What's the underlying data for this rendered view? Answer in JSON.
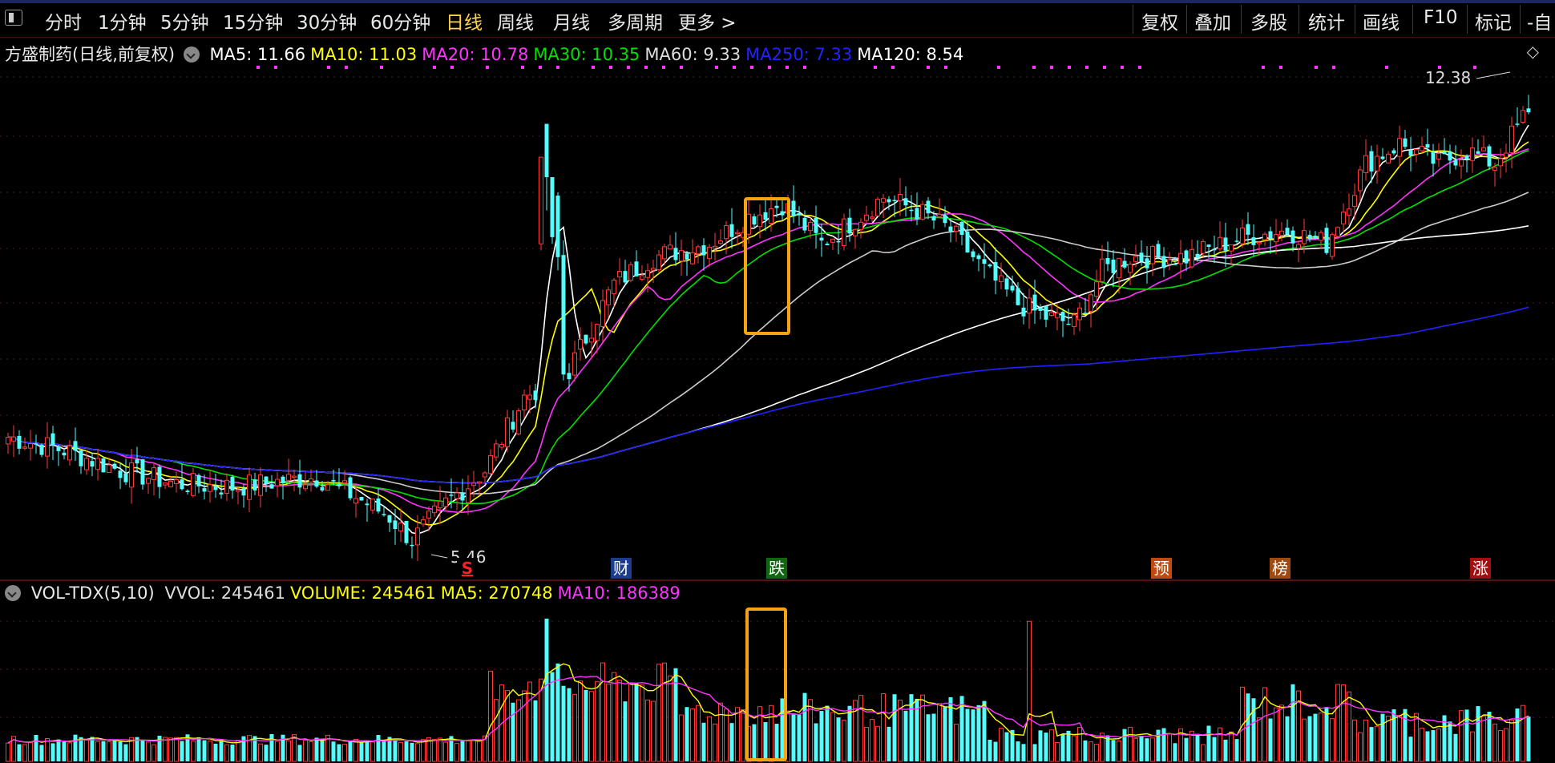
{
  "toolbar": {
    "tabs": [
      "分时",
      "1分钟",
      "5分钟",
      "15分钟",
      "30分钟",
      "60分钟",
      "日线",
      "周线",
      "月线",
      "多周期",
      "更多 >"
    ],
    "active_tab": "日线",
    "right_buttons": [
      "复权",
      "叠加",
      "多股",
      "统计",
      "画线",
      "F10",
      "标记",
      "-自"
    ]
  },
  "price_legend": {
    "title": "方盛制药(日线,前复权)",
    "items": [
      {
        "label": "MA5: 11.66",
        "color": "#ffffff"
      },
      {
        "label": "MA10: 11.03",
        "color": "#ffff00"
      },
      {
        "label": "MA20: 10.78",
        "color": "#ff33ff"
      },
      {
        "label": "MA30: 10.35",
        "color": "#00e000"
      },
      {
        "label": "MA60: 9.33",
        "color": "#dddddd"
      },
      {
        "label": "MA250: 7.33",
        "color": "#2222ff"
      },
      {
        "label": "MA120: 8.54",
        "color": "#ffffff"
      }
    ]
  },
  "annotations": {
    "high_label": "12.38",
    "low_label": "5.46"
  },
  "markers": [
    {
      "text": "S",
      "bg": "#000000",
      "color": "#ff2020"
    },
    {
      "text": "财",
      "bg": "#1e3c8c",
      "color": "#ffffff"
    },
    {
      "text": "跌",
      "bg": "#116611",
      "color": "#ffffff"
    },
    {
      "text": "预",
      "bg": "#c04a10",
      "color": "#ffffff"
    },
    {
      "text": "榜",
      "bg": "#a04a10",
      "color": "#ffffff"
    },
    {
      "text": "涨",
      "bg": "#a01010",
      "color": "#ffffff"
    }
  ],
  "vol_legend": {
    "title": "VOL-TDX(5,10)",
    "items": [
      {
        "label": "VVOL: 245461",
        "color": "#dddddd"
      },
      {
        "label": "VOLUME: 245461",
        "color": "#ffff00"
      },
      {
        "label": "MA5: 270748",
        "color": "#ffff00"
      },
      {
        "label": "MA10: 186389",
        "color": "#ff33ff"
      }
    ]
  },
  "colors": {
    "up": "#ff3b3b",
    "down": "#54fcfc",
    "highlight": "#f5a311",
    "background": "#000000"
  },
  "chart_data": {
    "type": "candlestick",
    "price_range": [
      5.3,
      12.6
    ],
    "close_anchors": [
      [
        0,
        7.1
      ],
      [
        10,
        6.9
      ],
      [
        20,
        6.6
      ],
      [
        30,
        6.4
      ],
      [
        40,
        6.35
      ],
      [
        55,
        6.5
      ],
      [
        62,
        6.2
      ],
      [
        68,
        5.9
      ],
      [
        72,
        5.55
      ],
      [
        78,
        6.1
      ],
      [
        85,
        6.6
      ],
      [
        92,
        7.7
      ],
      [
        100,
        8.1
      ],
      [
        108,
        9.4
      ],
      [
        115,
        9.8
      ],
      [
        125,
        10.0
      ],
      [
        132,
        10.4
      ],
      [
        138,
        10.6
      ],
      [
        145,
        10.0
      ],
      [
        150,
        10.3
      ],
      [
        156,
        10.7
      ],
      [
        162,
        10.5
      ],
      [
        168,
        10.2
      ],
      [
        174,
        9.6
      ],
      [
        180,
        9.1
      ],
      [
        185,
        8.9
      ],
      [
        190,
        8.8
      ],
      [
        195,
        9.6
      ],
      [
        200,
        9.8
      ],
      [
        210,
        9.8
      ],
      [
        220,
        10.1
      ],
      [
        228,
        10.2
      ],
      [
        235,
        10.0
      ],
      [
        242,
        11.2
      ],
      [
        248,
        11.5
      ],
      [
        255,
        11.2
      ],
      [
        260,
        11.4
      ],
      [
        265,
        11.2
      ],
      [
        270,
        11.9
      ]
    ],
    "volume_range": [
      0,
      540000
    ]
  }
}
